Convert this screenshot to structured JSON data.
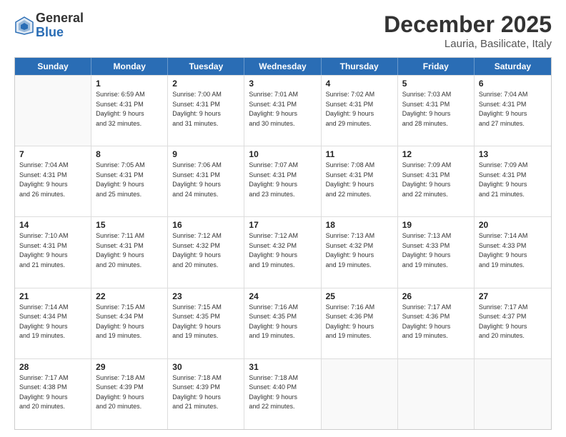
{
  "logo": {
    "general": "General",
    "blue": "Blue"
  },
  "header": {
    "month": "December 2025",
    "location": "Lauria, Basilicate, Italy"
  },
  "weekdays": [
    "Sunday",
    "Monday",
    "Tuesday",
    "Wednesday",
    "Thursday",
    "Friday",
    "Saturday"
  ],
  "weeks": [
    [
      {
        "day": "",
        "info": ""
      },
      {
        "day": "1",
        "info": "Sunrise: 6:59 AM\nSunset: 4:31 PM\nDaylight: 9 hours\nand 32 minutes."
      },
      {
        "day": "2",
        "info": "Sunrise: 7:00 AM\nSunset: 4:31 PM\nDaylight: 9 hours\nand 31 minutes."
      },
      {
        "day": "3",
        "info": "Sunrise: 7:01 AM\nSunset: 4:31 PM\nDaylight: 9 hours\nand 30 minutes."
      },
      {
        "day": "4",
        "info": "Sunrise: 7:02 AM\nSunset: 4:31 PM\nDaylight: 9 hours\nand 29 minutes."
      },
      {
        "day": "5",
        "info": "Sunrise: 7:03 AM\nSunset: 4:31 PM\nDaylight: 9 hours\nand 28 minutes."
      },
      {
        "day": "6",
        "info": "Sunrise: 7:04 AM\nSunset: 4:31 PM\nDaylight: 9 hours\nand 27 minutes."
      }
    ],
    [
      {
        "day": "7",
        "info": "Sunrise: 7:04 AM\nSunset: 4:31 PM\nDaylight: 9 hours\nand 26 minutes."
      },
      {
        "day": "8",
        "info": "Sunrise: 7:05 AM\nSunset: 4:31 PM\nDaylight: 9 hours\nand 25 minutes."
      },
      {
        "day": "9",
        "info": "Sunrise: 7:06 AM\nSunset: 4:31 PM\nDaylight: 9 hours\nand 24 minutes."
      },
      {
        "day": "10",
        "info": "Sunrise: 7:07 AM\nSunset: 4:31 PM\nDaylight: 9 hours\nand 23 minutes."
      },
      {
        "day": "11",
        "info": "Sunrise: 7:08 AM\nSunset: 4:31 PM\nDaylight: 9 hours\nand 22 minutes."
      },
      {
        "day": "12",
        "info": "Sunrise: 7:09 AM\nSunset: 4:31 PM\nDaylight: 9 hours\nand 22 minutes."
      },
      {
        "day": "13",
        "info": "Sunrise: 7:09 AM\nSunset: 4:31 PM\nDaylight: 9 hours\nand 21 minutes."
      }
    ],
    [
      {
        "day": "14",
        "info": "Sunrise: 7:10 AM\nSunset: 4:31 PM\nDaylight: 9 hours\nand 21 minutes."
      },
      {
        "day": "15",
        "info": "Sunrise: 7:11 AM\nSunset: 4:31 PM\nDaylight: 9 hours\nand 20 minutes."
      },
      {
        "day": "16",
        "info": "Sunrise: 7:12 AM\nSunset: 4:32 PM\nDaylight: 9 hours\nand 20 minutes."
      },
      {
        "day": "17",
        "info": "Sunrise: 7:12 AM\nSunset: 4:32 PM\nDaylight: 9 hours\nand 19 minutes."
      },
      {
        "day": "18",
        "info": "Sunrise: 7:13 AM\nSunset: 4:32 PM\nDaylight: 9 hours\nand 19 minutes."
      },
      {
        "day": "19",
        "info": "Sunrise: 7:13 AM\nSunset: 4:33 PM\nDaylight: 9 hours\nand 19 minutes."
      },
      {
        "day": "20",
        "info": "Sunrise: 7:14 AM\nSunset: 4:33 PM\nDaylight: 9 hours\nand 19 minutes."
      }
    ],
    [
      {
        "day": "21",
        "info": "Sunrise: 7:14 AM\nSunset: 4:34 PM\nDaylight: 9 hours\nand 19 minutes."
      },
      {
        "day": "22",
        "info": "Sunrise: 7:15 AM\nSunset: 4:34 PM\nDaylight: 9 hours\nand 19 minutes."
      },
      {
        "day": "23",
        "info": "Sunrise: 7:15 AM\nSunset: 4:35 PM\nDaylight: 9 hours\nand 19 minutes."
      },
      {
        "day": "24",
        "info": "Sunrise: 7:16 AM\nSunset: 4:35 PM\nDaylight: 9 hours\nand 19 minutes."
      },
      {
        "day": "25",
        "info": "Sunrise: 7:16 AM\nSunset: 4:36 PM\nDaylight: 9 hours\nand 19 minutes."
      },
      {
        "day": "26",
        "info": "Sunrise: 7:17 AM\nSunset: 4:36 PM\nDaylight: 9 hours\nand 19 minutes."
      },
      {
        "day": "27",
        "info": "Sunrise: 7:17 AM\nSunset: 4:37 PM\nDaylight: 9 hours\nand 20 minutes."
      }
    ],
    [
      {
        "day": "28",
        "info": "Sunrise: 7:17 AM\nSunset: 4:38 PM\nDaylight: 9 hours\nand 20 minutes."
      },
      {
        "day": "29",
        "info": "Sunrise: 7:18 AM\nSunset: 4:39 PM\nDaylight: 9 hours\nand 20 minutes."
      },
      {
        "day": "30",
        "info": "Sunrise: 7:18 AM\nSunset: 4:39 PM\nDaylight: 9 hours\nand 21 minutes."
      },
      {
        "day": "31",
        "info": "Sunrise: 7:18 AM\nSunset: 4:40 PM\nDaylight: 9 hours\nand 22 minutes."
      },
      {
        "day": "",
        "info": ""
      },
      {
        "day": "",
        "info": ""
      },
      {
        "day": "",
        "info": ""
      }
    ]
  ]
}
